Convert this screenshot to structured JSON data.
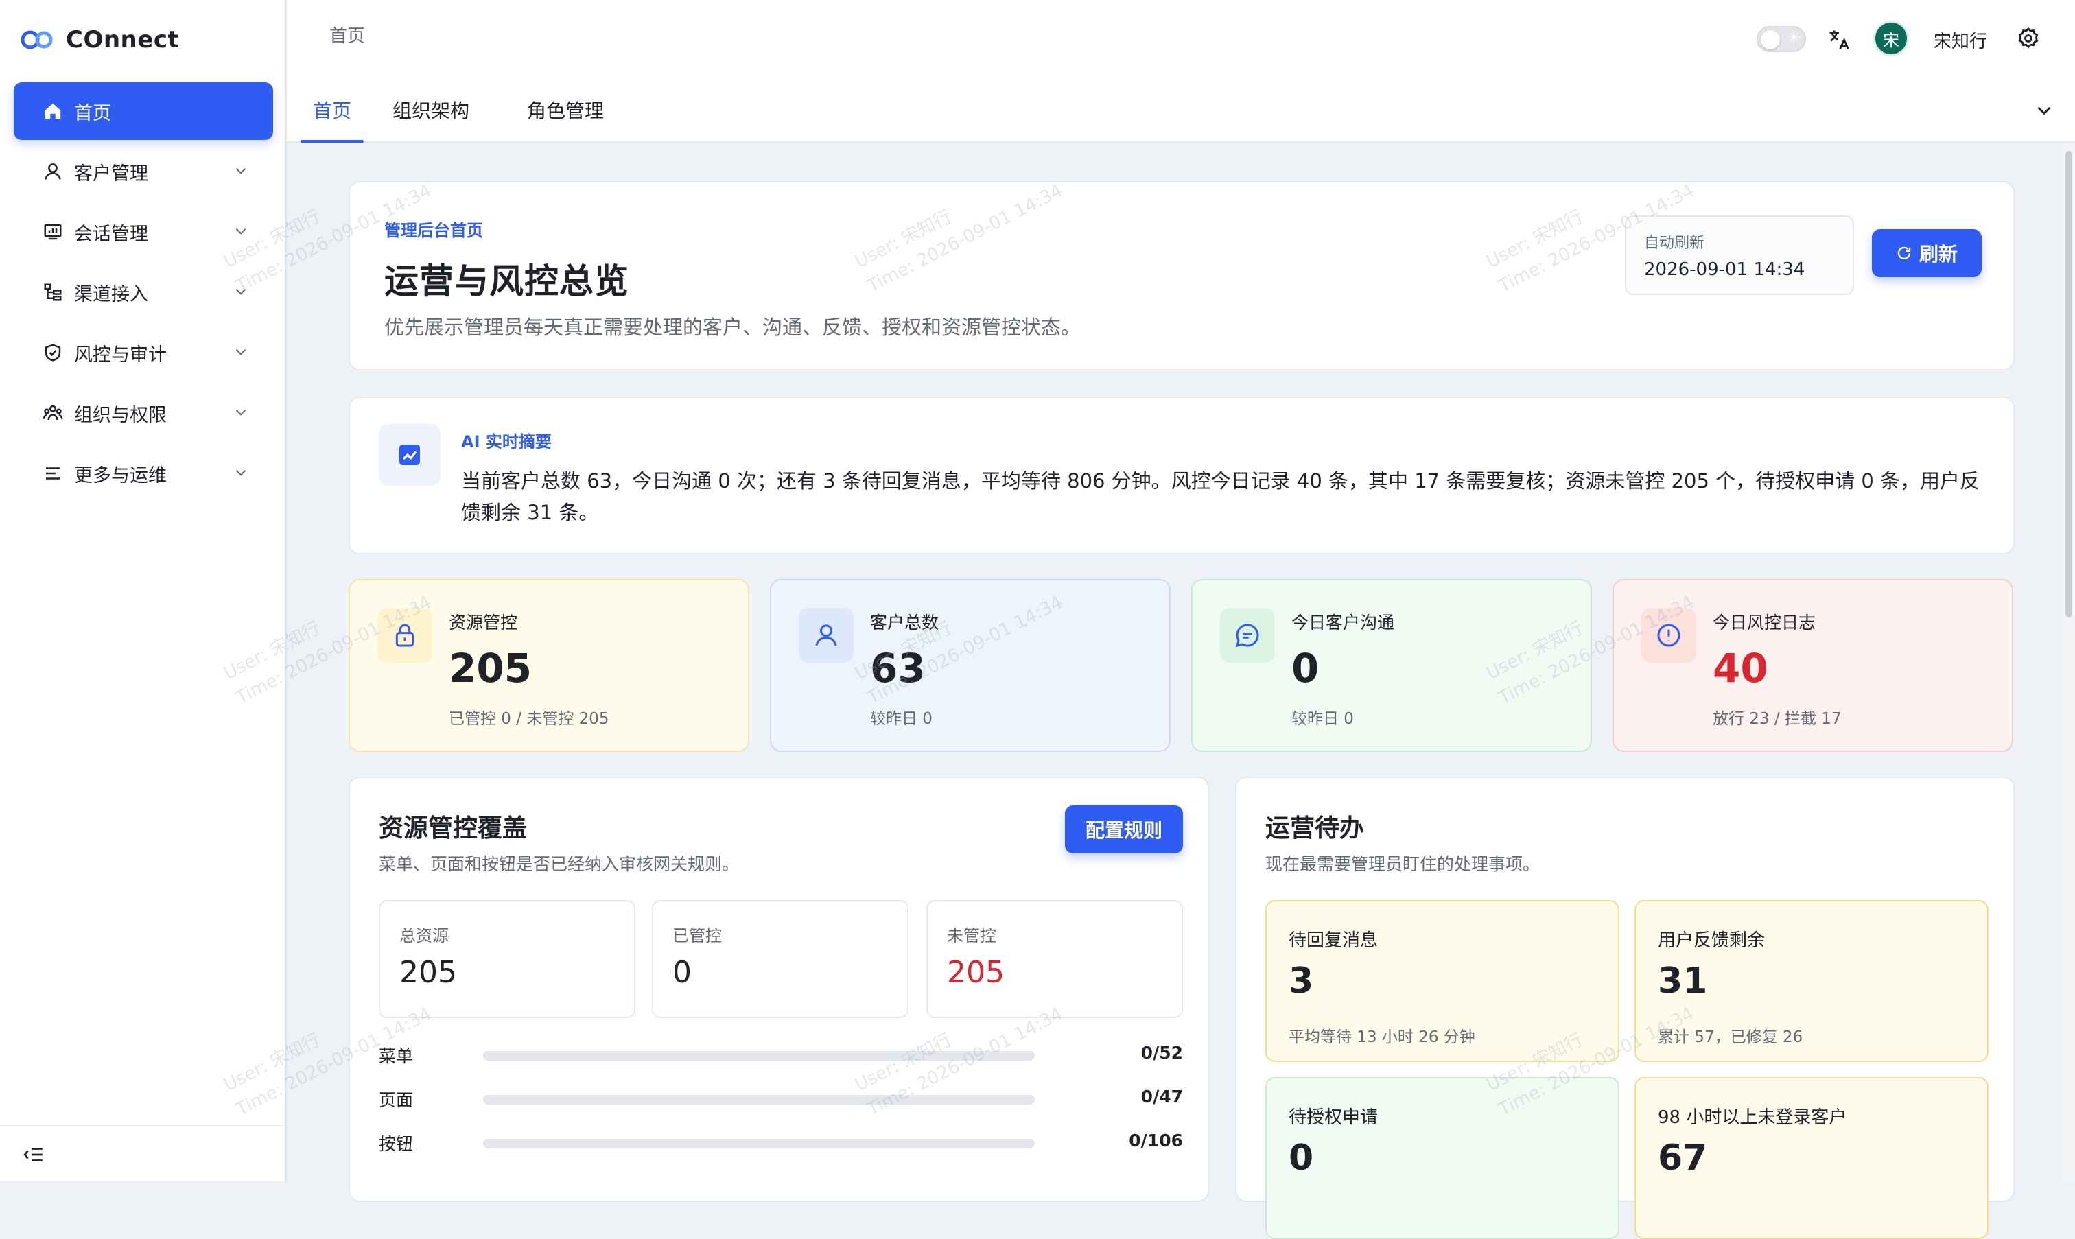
{
  "app": {
    "name": "COnnect"
  },
  "colors": {
    "primary": "#2f5cf2",
    "danger": "#d9252f",
    "text": "#1f2329",
    "muted": "#646a73"
  },
  "sidebar": {
    "items": [
      {
        "label": "首页",
        "icon": "home-icon",
        "active": true
      },
      {
        "label": "客户管理",
        "icon": "user-icon"
      },
      {
        "label": "会话管理",
        "icon": "chat-board-icon"
      },
      {
        "label": "渠道接入",
        "icon": "tree-icon"
      },
      {
        "label": "风控与审计",
        "icon": "shield-icon"
      },
      {
        "label": "组织与权限",
        "icon": "team-icon"
      },
      {
        "label": "更多与运维",
        "icon": "list-icon"
      }
    ],
    "collapse_icon": "menu-fold-icon"
  },
  "header": {
    "breadcrumb": "首页",
    "user": {
      "avatar": "宋",
      "name": "宋知行"
    },
    "tabs": [
      {
        "label": "首页",
        "active": true
      },
      {
        "label": "组织架构"
      },
      {
        "label": "角色管理"
      }
    ]
  },
  "hero": {
    "eyebrow": "管理后台首页",
    "title": "运营与风控总览",
    "subtitle": "优先展示管理员每天真正需要处理的客户、沟通、反馈、授权和资源管控状态。",
    "auto_refresh_label": "自动刷新",
    "auto_refresh_time": "2026-09-01 14:34",
    "refresh_button": "刷新"
  },
  "ai_summary": {
    "title": "AI 实时摘要",
    "text": "当前客户总数 63，今日沟通 0 次；还有 3 条待回复消息，平均等待 806 分钟。风控今日记录 40 条，其中 17 条需要复核；资源未管控 205 个，待授权申请 0 条，用户反馈剩余 31 条。"
  },
  "stats": [
    {
      "label": "资源管控",
      "value": "205",
      "sub": "已管控 0 / 未管控 205",
      "icon": "lock-icon",
      "tone": "yellow"
    },
    {
      "label": "客户总数",
      "value": "63",
      "sub": "较昨日 0",
      "icon": "user-icon",
      "tone": "blue"
    },
    {
      "label": "今日客户沟通",
      "value": "0",
      "sub": "较昨日 0",
      "icon": "message-icon",
      "tone": "green"
    },
    {
      "label": "今日风控日志",
      "value": "40",
      "sub": "放行 23 / 拦截 17",
      "icon": "alert-icon",
      "tone": "red"
    }
  ],
  "coverage": {
    "title": "资源管控覆盖",
    "subtitle": "菜单、页面和按钮是否已经纳入审核网关规则。",
    "config_button": "配置规则",
    "totals": [
      {
        "label": "总资源",
        "value": "205"
      },
      {
        "label": "已管控",
        "value": "0"
      },
      {
        "label": "未管控",
        "value": "205",
        "danger": true
      }
    ],
    "rows": [
      {
        "label": "菜单",
        "value": "0/52",
        "fraction": 0
      },
      {
        "label": "页面",
        "value": "0/47",
        "fraction": 0
      },
      {
        "label": "按钮",
        "value": "0/106",
        "fraction": 0
      }
    ]
  },
  "todo": {
    "title": "运营待办",
    "subtitle": "现在最需要管理员盯住的处理事项。",
    "items": [
      {
        "label": "待回复消息",
        "value": "3",
        "sub": "平均等待 13 小时 26 分钟",
        "tone": "yellow"
      },
      {
        "label": "用户反馈剩余",
        "value": "31",
        "sub": "累计 57，已修复 26",
        "tone": "yellow"
      },
      {
        "label": "待授权申请",
        "value": "0",
        "sub": "",
        "tone": "green"
      },
      {
        "label": "98 小时以上未登录客户",
        "value": "67",
        "sub": "",
        "tone": "yellow"
      }
    ]
  },
  "watermark": {
    "user": "User: 宋知行",
    "time": "Time: 2026-09-01 14:34"
  }
}
